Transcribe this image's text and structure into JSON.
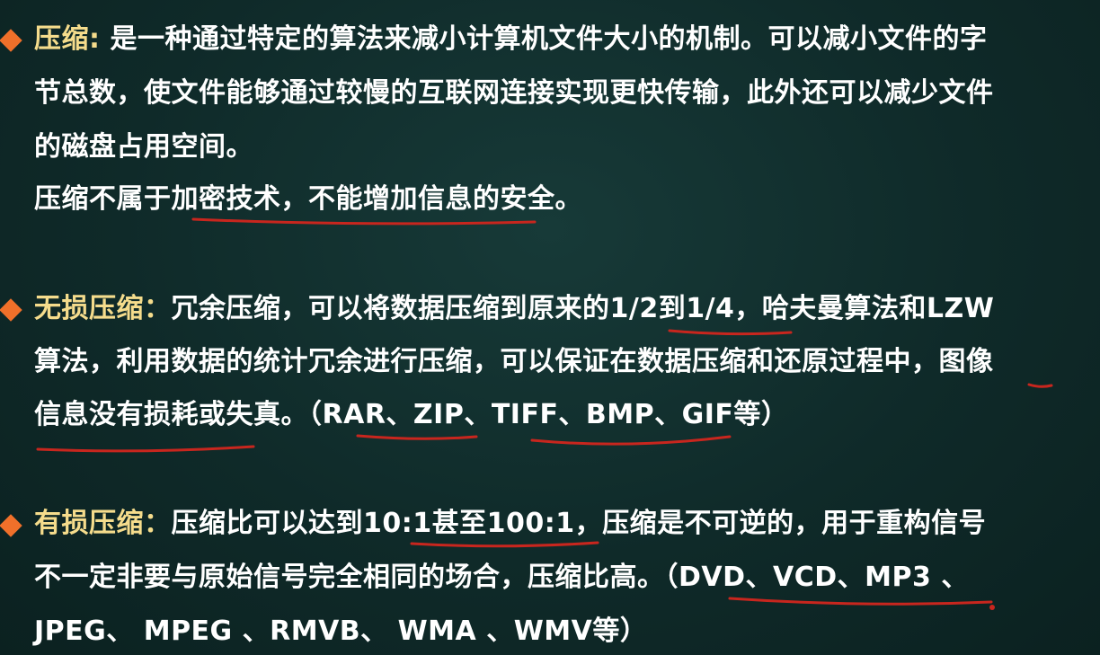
{
  "section1": {
    "term": "压缩:",
    "line1": " 是一种通过特定的算法来减小计算机文件大小的机制。可以减小文件的字",
    "line2": "节总数，使文件能够通过较慢的互联网连接实现更快传输，此外还可以减少文件",
    "line3": "的磁盘占用空间。",
    "line4": "压缩不属于加密技术，不能增加信息的安全。"
  },
  "section2": {
    "term": "无损压缩：",
    "line1": "冗余压缩，可以将数据压缩到原来的1/2到1/4，哈夫曼算法和LZW",
    "line2": "算法，利用数据的统计冗余进行压缩，可以保证在数据压缩和还原过程中，图像",
    "line3": "信息没有损耗或失真。（RAR、ZIP、TIFF、BMP、GIF等）"
  },
  "section3": {
    "term": "有损压缩：",
    "line1": "压缩比可以达到10:1甚至100:1，压缩是不可逆的，用于重构信号",
    "line2": "不一定非要与原始信号完全相同的场合，压缩比高。（DVD、VCD、MP3 、",
    "line3": "JPEG、 MPEG 、RMVB、 WMA 、WMV等）"
  },
  "colors": {
    "background": "#0f2a29",
    "text": "#ffffff",
    "term": "#f5dc8c",
    "bullet": "#f0702a",
    "annotation": "#c8261e"
  }
}
